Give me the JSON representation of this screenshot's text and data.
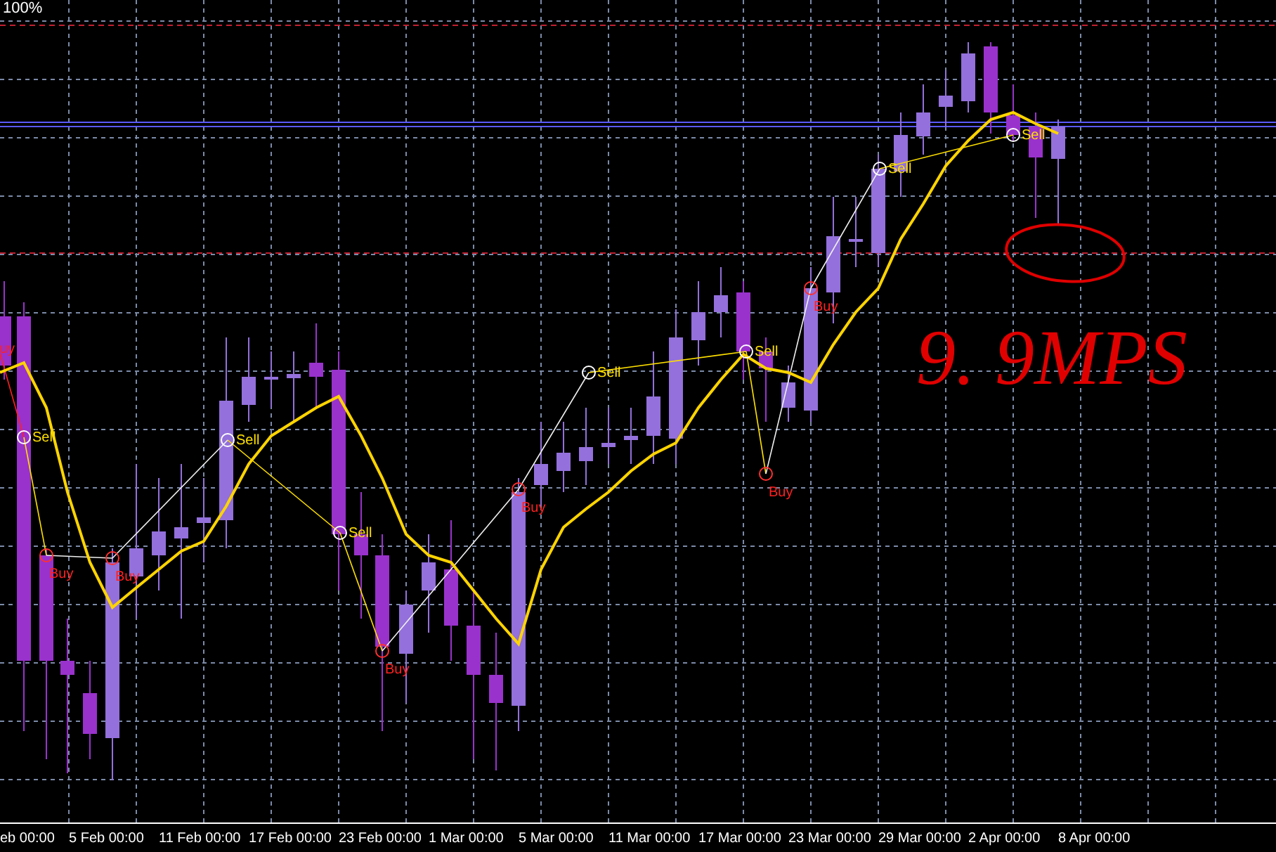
{
  "zoom_label": "100%",
  "signals": [
    {
      "kind": "buy",
      "label": "uy"
    },
    {
      "kind": "sell",
      "label": "Sell"
    },
    {
      "kind": "buy",
      "label": "Buy"
    },
    {
      "kind": "buy",
      "label": "Buy"
    },
    {
      "kind": "sell",
      "label": "Sell"
    },
    {
      "kind": "sell",
      "label": "Sell"
    },
    {
      "kind": "buy",
      "label": "Buy"
    },
    {
      "kind": "buy",
      "label": "Buy"
    },
    {
      "kind": "sell",
      "label": "Sell"
    },
    {
      "kind": "sell",
      "label": "Sell"
    },
    {
      "kind": "buy",
      "label": "Buy"
    },
    {
      "kind": "buy",
      "label": "Buy"
    },
    {
      "kind": "sell",
      "label": "Sell"
    },
    {
      "kind": "sell",
      "label": "Sell"
    }
  ],
  "annotation": {
    "text": "9. 9MPS"
  },
  "x_axis_labels": [
    "eb 00:00",
    "5 Feb 00:00",
    "11 Feb 00:00",
    "17 Feb 00:00",
    "23 Feb 00:00",
    "1 Mar 00:00",
    "5 Mar 00:00",
    "11 Mar 00:00",
    "17 Mar 00:00",
    "23 Mar 00:00",
    "29 Mar 00:00",
    "2 Apr 00:00",
    "8 Apr 00:00"
  ]
}
